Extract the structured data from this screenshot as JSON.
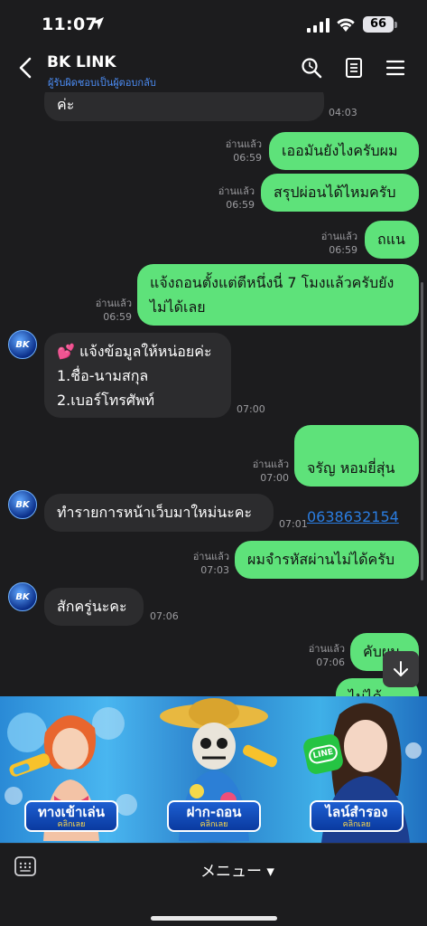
{
  "status_bar": {
    "time": "11:07",
    "battery": "66"
  },
  "header": {
    "title": "BK LINK",
    "subtitle": "ผู้รับผิดชอบเป็นผู้ตอบกลับ"
  },
  "messages": [
    {
      "id": "m0",
      "side": "recv",
      "text": "ค่ะ",
      "time": "04:03"
    },
    {
      "id": "m1",
      "side": "sent",
      "text": "เออมันยังไงครับผม",
      "read": "อ่านแล้ว",
      "time": "06:59"
    },
    {
      "id": "m2",
      "side": "sent",
      "text": "สรุปผ่อนได้ไหมครับ",
      "read": "อ่านแล้ว",
      "time": "06:59"
    },
    {
      "id": "m3",
      "side": "sent",
      "text": "ถแน",
      "read": "อ่านแล้ว",
      "time": "06:59"
    },
    {
      "id": "m4",
      "side": "sent",
      "text": "แจ้งถอนตั้งแต่ตีหนึ่งนี่ 7 โมงแล้วครับยัง\nไม่ได้เลย",
      "read": "อ่านแล้ว",
      "time": "06:59"
    },
    {
      "id": "m5",
      "side": "recv",
      "text": "💕 แจ้งข้อมูลให้หน่อยค่ะ\n1.ชื่อ-นามสกุล\n2.เบอร์โทรศัพท์",
      "time": "07:00"
    },
    {
      "id": "m6",
      "side": "sent",
      "text": "จรัญ  หอมยี่สุ่น",
      "phone": "0638632154",
      "read": "อ่านแล้ว",
      "time": "07:00"
    },
    {
      "id": "m7",
      "side": "recv",
      "text": "ทำรายการหน้าเว็บมาใหม่นะคะ",
      "time": "07:01"
    },
    {
      "id": "m8",
      "side": "sent",
      "text": "ผมจำรหัสผ่านไม่ได้ครับ",
      "read": "อ่านแล้ว",
      "time": "07:03"
    },
    {
      "id": "m9",
      "side": "recv",
      "text": "สักครู่นะคะ",
      "time": "07:06"
    },
    {
      "id": "m10",
      "side": "sent",
      "text": "คับผม",
      "read": "อ่านแล้ว",
      "time": "07:06"
    },
    {
      "id": "m11",
      "side": "sent",
      "text": "ไม่ได้ครับ"
    }
  ],
  "avatar_text": "BK",
  "banner": {
    "buttons": [
      {
        "label": "ทางเข้าเล่น",
        "sub": "คลิกเลย"
      },
      {
        "label": "ฝาก-ถอน",
        "sub": "คลิกเลย"
      },
      {
        "label": "ไลน์สำรอง",
        "sub": "คลิกเลย"
      }
    ],
    "line_badge": "LINE"
  },
  "footer": {
    "menu_label": "メニュー ▾"
  },
  "colors": {
    "sent_bubble": "#5ee27a",
    "recv_bubble": "#2c2c2e",
    "background": "#1c1c1e",
    "link": "#2a7de1",
    "subtitle": "#4c8df5"
  },
  "icons": [
    "location-arrow-icon",
    "signal-icon",
    "wifi-icon",
    "back-chevron-icon",
    "search-icon",
    "notes-icon",
    "hamburger-menu-icon",
    "arrow-down-icon",
    "keyboard-icon"
  ]
}
